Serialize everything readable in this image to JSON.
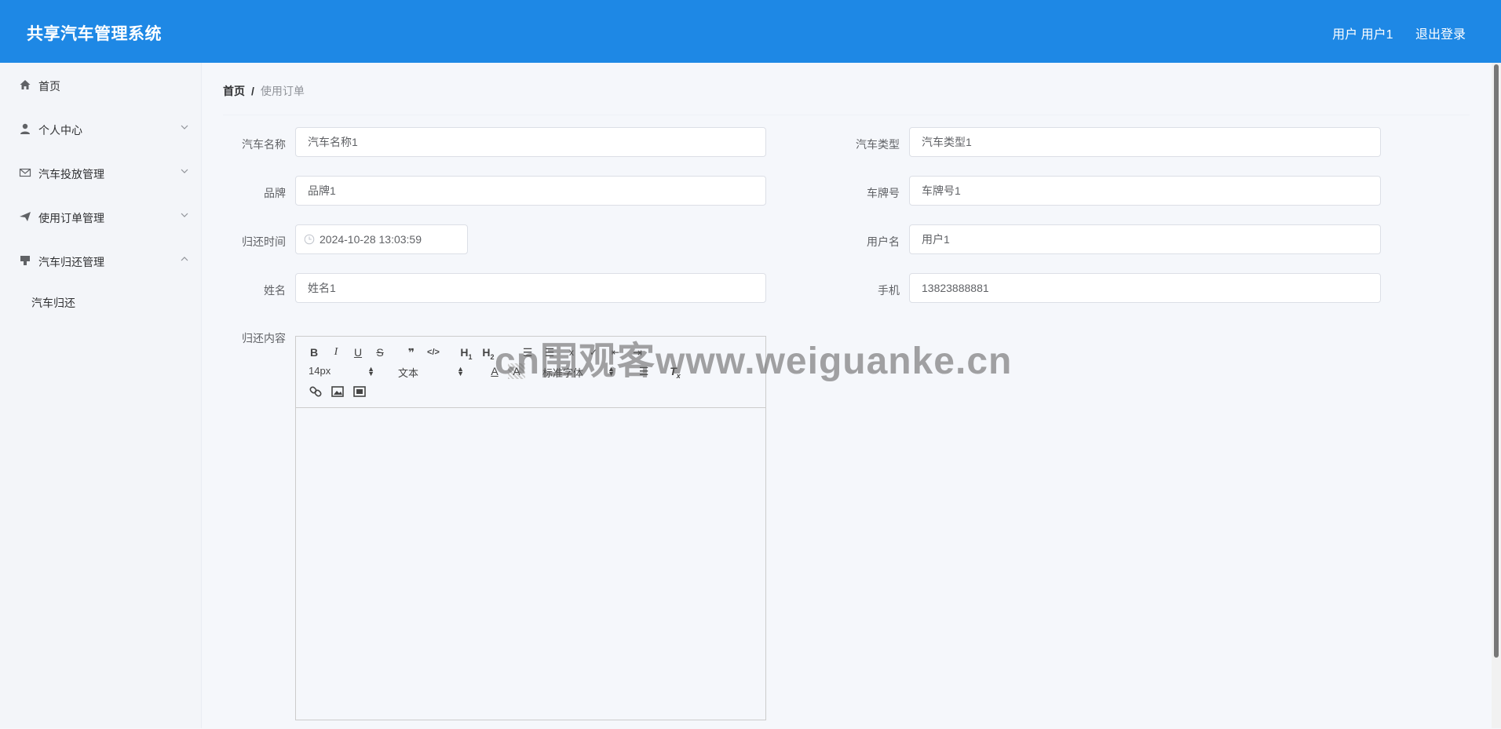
{
  "header": {
    "app_title": "共享汽车管理系统",
    "user_label": "用户 用户1",
    "logout_label": "退出登录"
  },
  "sidebar": {
    "items": [
      {
        "label": "首页",
        "icon": "home-icon"
      },
      {
        "label": "个人中心",
        "icon": "user-icon"
      },
      {
        "label": "汽车投放管理",
        "icon": "mail-icon"
      },
      {
        "label": "使用订单管理",
        "icon": "send-icon"
      },
      {
        "label": "汽车归还管理",
        "icon": "printer-icon"
      }
    ],
    "subitem": "汽车归还"
  },
  "breadcrumb": {
    "home": "首页",
    "separator": "/",
    "current": "使用订单"
  },
  "form": {
    "car_name": {
      "label": "汽车名称",
      "value": "汽车名称1"
    },
    "car_type": {
      "label": "汽车类型",
      "value": "汽车类型1"
    },
    "brand": {
      "label": "品牌",
      "value": "品牌1"
    },
    "plate": {
      "label": "车牌号",
      "value": "车牌号1"
    },
    "return_time": {
      "label": "归还时间",
      "value": "2024-10-28 13:03:59"
    },
    "username": {
      "label": "用户名",
      "value": "用户1"
    },
    "name": {
      "label": "姓名",
      "value": "姓名1"
    },
    "phone": {
      "label": "手机",
      "value": "13823888881"
    },
    "content": {
      "label": "归还内容",
      "value": ""
    }
  },
  "editor": {
    "font_size": "14px",
    "paragraph": "文本",
    "font_family": "标准字体"
  },
  "watermark": "cn围观客www.weiguanke.cn",
  "colors": {
    "primary": "#1e88e5",
    "sidebar_bg": "#f3f5f9",
    "page_bg": "#f5f7fb"
  }
}
